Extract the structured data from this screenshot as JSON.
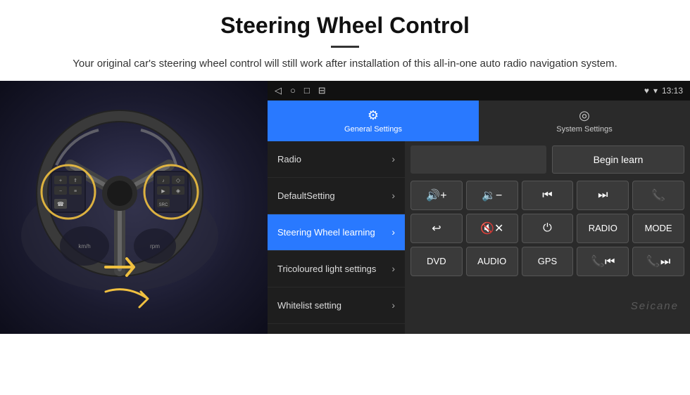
{
  "header": {
    "title": "Steering Wheel Control",
    "divider": true,
    "subtitle": "Your original car's steering wheel control will still work after installation of this all-in-one auto radio navigation system."
  },
  "status_bar": {
    "icons": [
      "◁",
      "○",
      "□",
      "⊟"
    ],
    "right_icons": "♥ ▾",
    "time": "13:13"
  },
  "tabs": [
    {
      "id": "general",
      "label": "General Settings",
      "icon": "⚙",
      "active": true
    },
    {
      "id": "system",
      "label": "System Settings",
      "icon": "◎",
      "active": false
    }
  ],
  "menu_items": [
    {
      "id": "radio",
      "label": "Radio",
      "active": false
    },
    {
      "id": "default_setting",
      "label": "DefaultSetting",
      "active": false
    },
    {
      "id": "steering_wheel",
      "label": "Steering Wheel learning",
      "active": true
    },
    {
      "id": "tricoloured",
      "label": "Tricoloured light settings",
      "active": false
    },
    {
      "id": "whitelist",
      "label": "Whitelist setting",
      "active": false
    }
  ],
  "control_panel": {
    "begin_learn_label": "Begin learn",
    "buttons_row1": [
      {
        "id": "vol_up",
        "symbol": "🔊+",
        "label": "Vol+"
      },
      {
        "id": "vol_down",
        "symbol": "🔉−",
        "label": "Vol-"
      },
      {
        "id": "prev_track",
        "symbol": "⏮",
        "label": "Prev"
      },
      {
        "id": "next_track",
        "symbol": "⏭",
        "label": "Next"
      },
      {
        "id": "phone",
        "symbol": "📞",
        "label": "Phone"
      }
    ],
    "buttons_row2": [
      {
        "id": "hangup",
        "symbol": "↩",
        "label": "Hangup"
      },
      {
        "id": "mute",
        "symbol": "🔇x",
        "label": "Mute"
      },
      {
        "id": "power",
        "symbol": "⏻",
        "label": "Power"
      },
      {
        "id": "radio",
        "symbol": "RADIO",
        "label": "Radio"
      },
      {
        "id": "mode",
        "symbol": "MODE",
        "label": "Mode"
      }
    ],
    "buttons_row3": [
      {
        "id": "dvd",
        "symbol": "DVD",
        "label": "DVD"
      },
      {
        "id": "audio",
        "symbol": "AUDIO",
        "label": "Audio"
      },
      {
        "id": "gps",
        "symbol": "GPS",
        "label": "GPS"
      },
      {
        "id": "tel_prev",
        "symbol": "📞⏮",
        "label": "Tel Prev"
      },
      {
        "id": "tel_next",
        "symbol": "📞⏭",
        "label": "Tel Next"
      }
    ]
  },
  "watermark": "Seicane",
  "colors": {
    "accent_blue": "#2979ff",
    "dark_bg": "#1a1a1a",
    "panel_bg": "#2a2a2a",
    "btn_bg": "#3a3a3a",
    "active_menu": "#2979ff"
  }
}
